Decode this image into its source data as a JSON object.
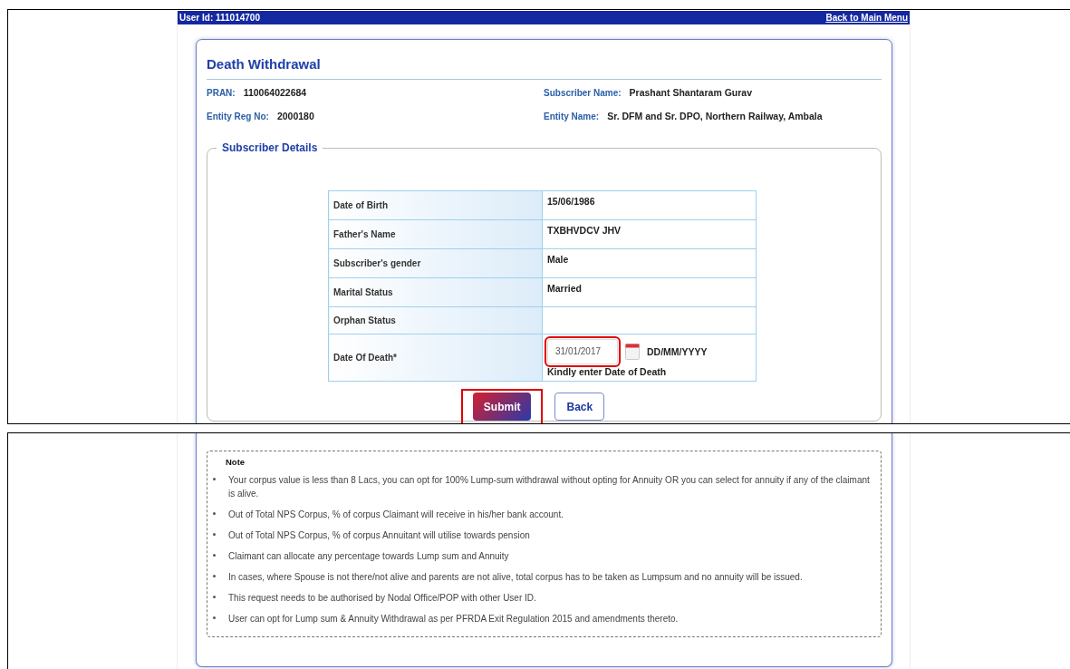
{
  "header": {
    "user_id": "User Id: 111014700",
    "back_link": "Back to Main Menu"
  },
  "title": "Death Withdrawal",
  "info": [
    {
      "label": "PRAN:",
      "value": "110064022684"
    },
    {
      "label": "Subscriber Name:",
      "value": "Prashant Shantaram Gurav"
    },
    {
      "label": "Entity Reg No:",
      "value": "2000180"
    },
    {
      "label": "Entity Name:",
      "value": "Sr. DFM and Sr. DPO, Northern Railway, Ambala"
    }
  ],
  "section": {
    "legend": "Subscriber Details",
    "rows": [
      {
        "kind": "text",
        "label": "Date of Birth",
        "value": "15/06/1986"
      },
      {
        "kind": "text",
        "label": "Father's Name",
        "value": "TXBHVDCV JHV"
      },
      {
        "kind": "text",
        "label": "Subscriber's gender",
        "value": "Male"
      },
      {
        "kind": "text",
        "label": "Marital Status",
        "value": "Married"
      },
      {
        "kind": "text",
        "label": "Orphan Status"
      },
      {
        "kind": "date",
        "label": "Date Of Death*",
        "value": "31/01/2017",
        "highlighted": true,
        "format": "DD/MM/YYYY",
        "hint": "Kindly enter Date of Death"
      }
    ]
  },
  "buttons": [
    {
      "label": "Submit",
      "kind": "primary",
      "highlighted": true
    },
    {
      "label": "Back",
      "kind": "secondary",
      "highlighted": false
    }
  ],
  "note": {
    "title": "Note",
    "items": [
      "Your corpus value is less than 8 Lacs, you can opt for 100% Lump-sum withdrawal without opting for Annuity OR you can select for annuity if any of the claimant is alive.",
      "Out of Total NPS Corpus, % of corpus Claimant will receive in his/her bank account.",
      "Out of Total NPS Corpus, % of corpus Annuitant will utilise towards pension",
      "Claimant can allocate any percentage towards Lump sum and Annuity",
      "In cases, where Spouse is not there/not alive and parents are not alive, total corpus has to be taken as Lumpsum and no annuity will be issued.",
      "This request needs to be authorised by Nodal Office/POP with other User ID.",
      "User can opt for Lump sum & Annuity Withdrawal as per PFRDA Exit Regulation 2015 and amendments thereto."
    ]
  }
}
